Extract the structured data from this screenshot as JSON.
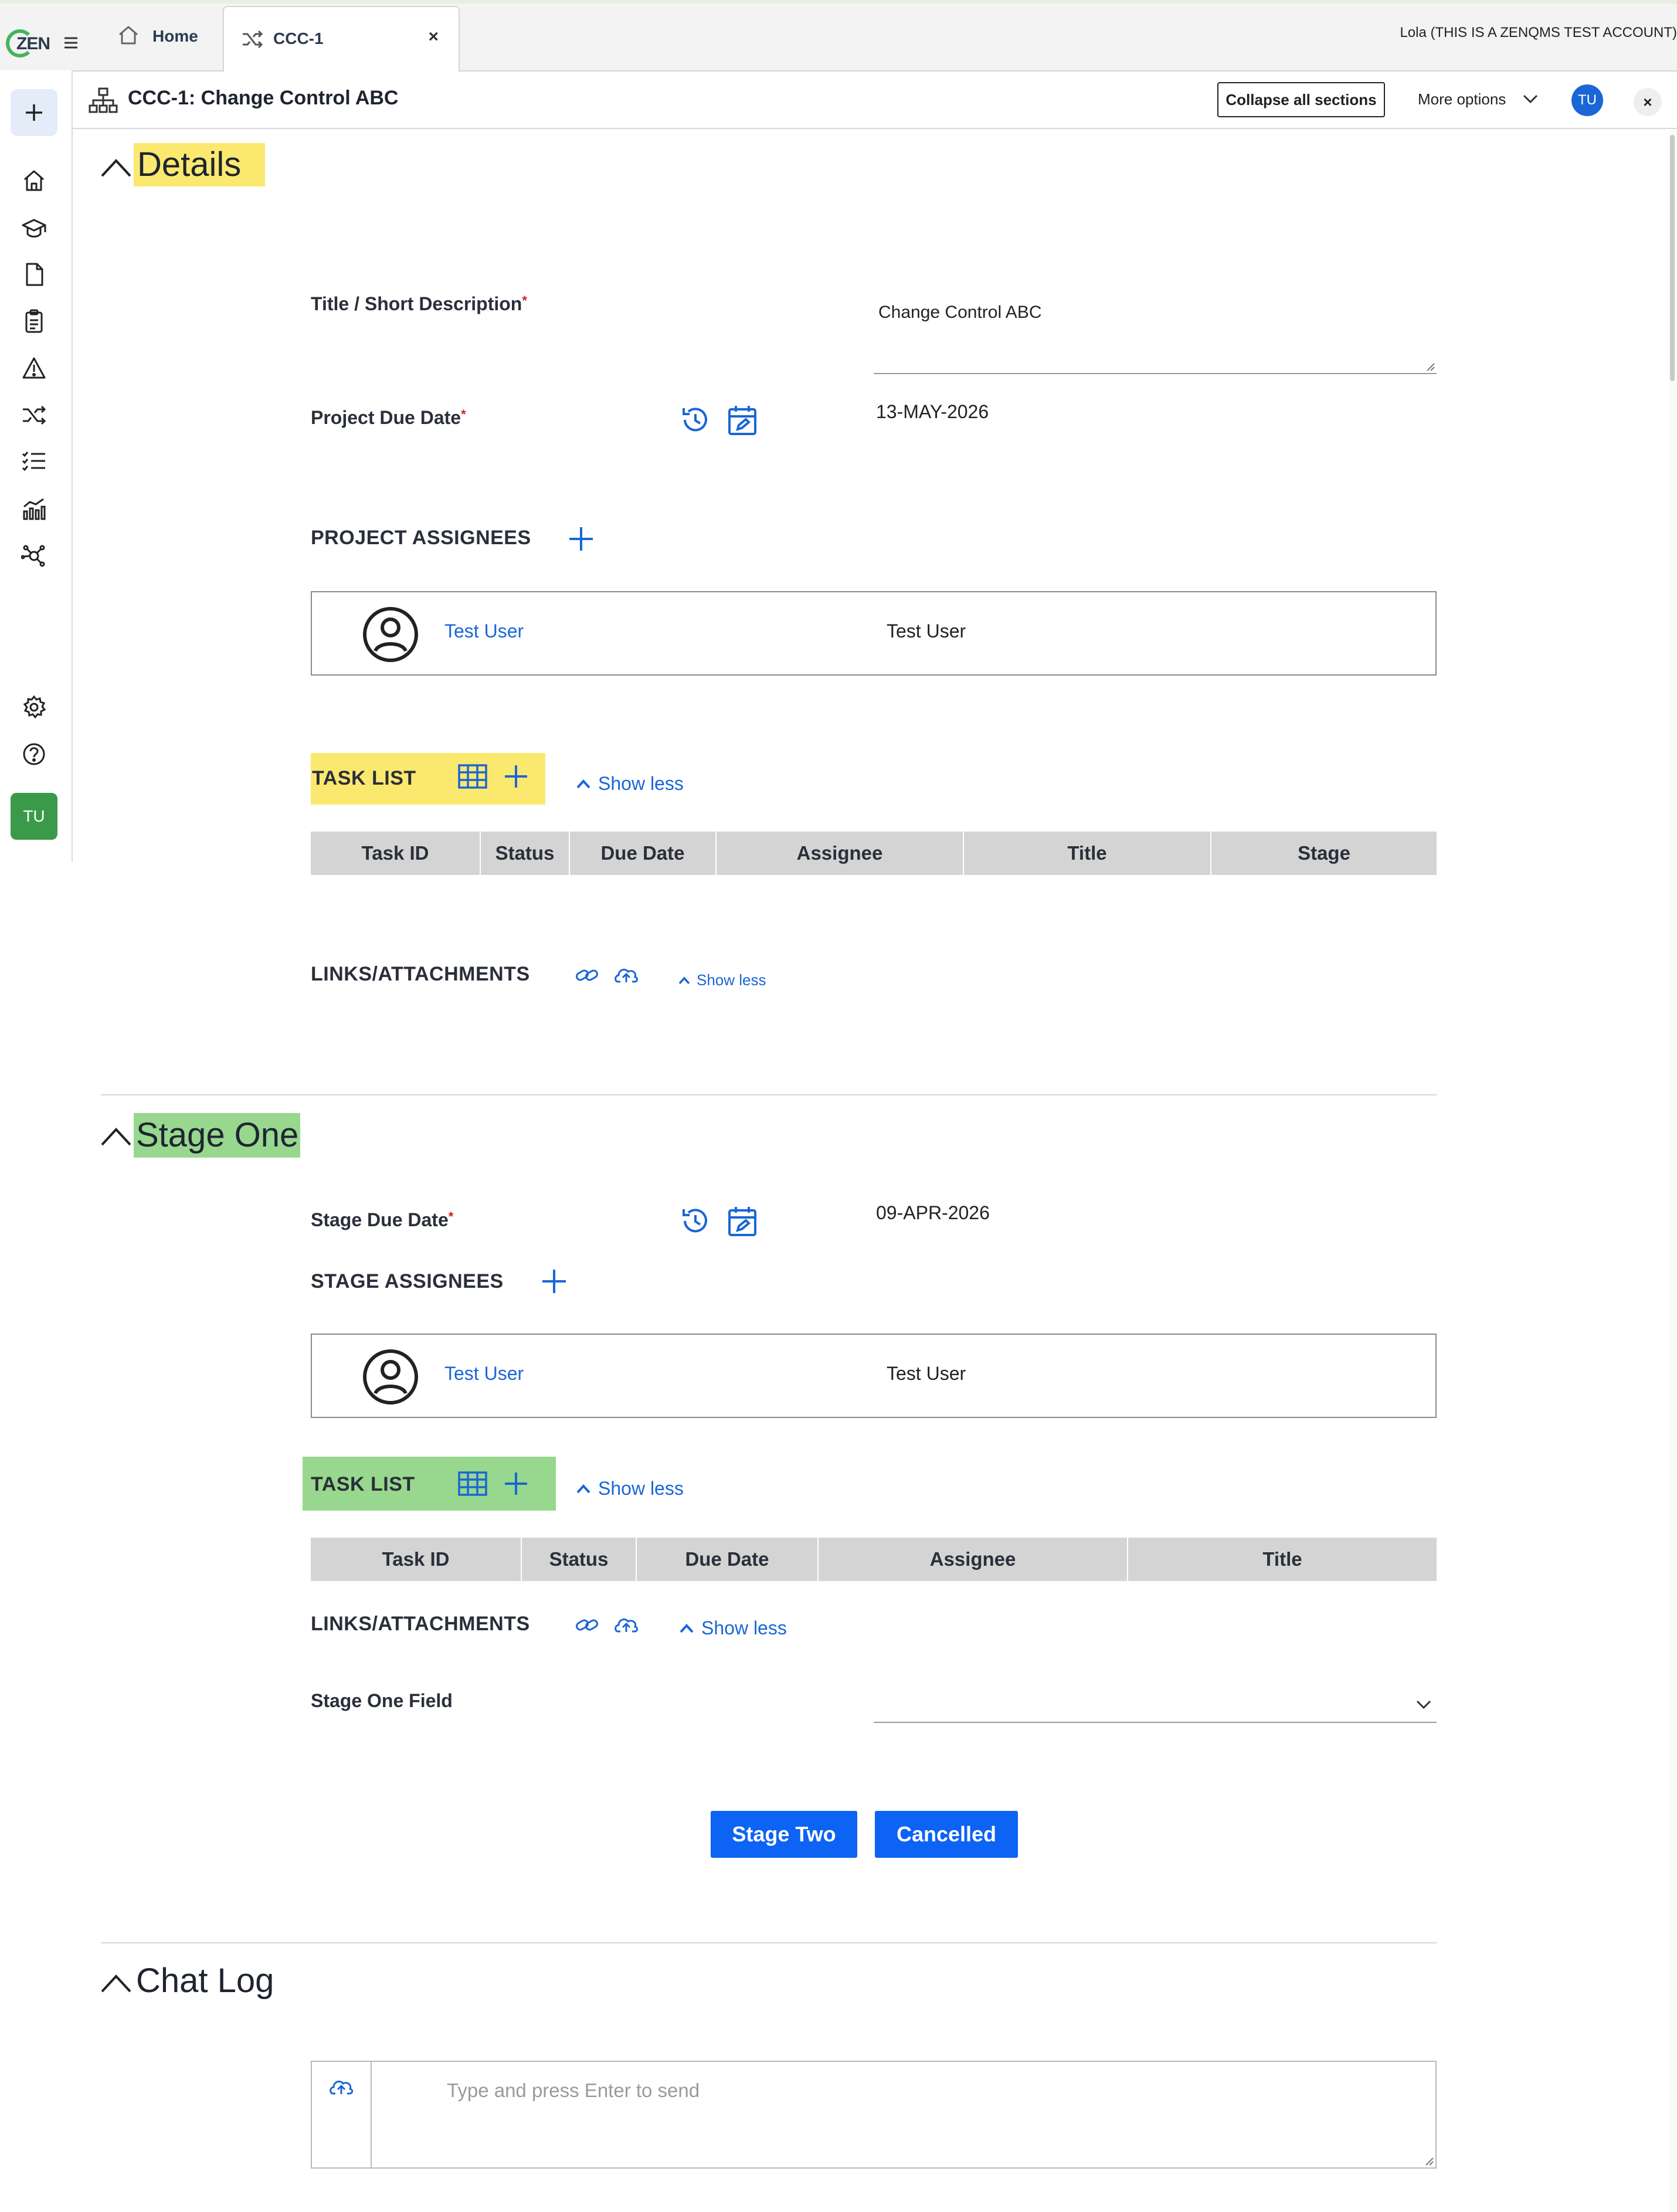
{
  "app": {
    "logo_text": "ZEN",
    "account_label": "Lola (THIS IS A ZENQMS TEST ACCOUNT)"
  },
  "tabs": [
    {
      "label": "Home",
      "icon": "home-icon"
    },
    {
      "label": "CCC-1",
      "icon": "shuffle-icon",
      "close": "×"
    }
  ],
  "sidebar": {
    "items": [
      {
        "name": "add",
        "icon": "plus-icon"
      },
      {
        "name": "home",
        "icon": "home-icon"
      },
      {
        "name": "training",
        "icon": "graduation-cap-icon"
      },
      {
        "name": "documents",
        "icon": "document-icon"
      },
      {
        "name": "audits",
        "icon": "clipboard-icon"
      },
      {
        "name": "issues",
        "icon": "warning-icon"
      },
      {
        "name": "change-control",
        "icon": "shuffle-icon"
      },
      {
        "name": "tasks",
        "icon": "checklist-icon"
      },
      {
        "name": "reports",
        "icon": "bar-chart-icon"
      },
      {
        "name": "network",
        "icon": "network-icon"
      },
      {
        "name": "settings",
        "icon": "gear-icon"
      },
      {
        "name": "help",
        "icon": "help-icon"
      }
    ],
    "user_initials": "TU"
  },
  "header": {
    "title": "CCC-1: Change Control ABC",
    "collapse_label": "Collapse all sections",
    "more_options": "More options",
    "avatar_initials": "TU",
    "close": "×"
  },
  "details": {
    "heading": "Details",
    "title_label": "Title / Short Description",
    "title_value": "Change Control ABC",
    "due_label": "Project Due Date",
    "due_value": "13-MAY-2026",
    "assignees_label": "PROJECT ASSIGNEES",
    "assignee": {
      "name_link": "Test User",
      "name": "Test User"
    },
    "task_list_label": "TASK LIST",
    "show_less": "Show less",
    "task_columns": [
      "Task ID",
      "Status",
      "Due Date",
      "Assignee",
      "Title",
      "Stage"
    ],
    "links_label": "LINKS/ATTACHMENTS",
    "links_show_less": "Show less"
  },
  "stage_one": {
    "heading": "Stage One",
    "due_label": "Stage Due Date",
    "due_value": "09-APR-2026",
    "assignees_label": "STAGE ASSIGNEES",
    "assignee": {
      "name_link": "Test User",
      "name": "Test User"
    },
    "task_list_label": "TASK LIST",
    "show_less": "Show less",
    "task_columns": [
      "Task ID",
      "Status",
      "Due Date",
      "Assignee",
      "Title"
    ],
    "links_label": "LINKS/ATTACHMENTS",
    "links_show_less": "Show less",
    "field_label": "Stage One Field",
    "field_value": "",
    "buttons": [
      "Stage Two",
      "Cancelled"
    ]
  },
  "chat_log": {
    "heading": "Chat Log",
    "placeholder": "Type and press Enter to send"
  },
  "colors": {
    "accent": "#1a66d6",
    "button": "#0c63f4",
    "highlight_yellow": "#fbe96f",
    "highlight_green": "#98d78e",
    "required": "#d02020"
  }
}
